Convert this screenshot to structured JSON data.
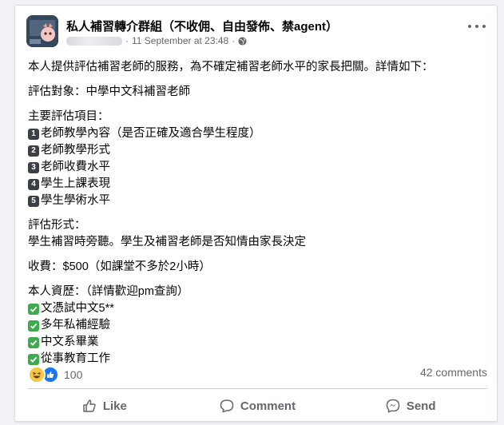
{
  "post": {
    "group_name": "私人補習轉介群組（不收佣、自由發佈、禁agent）",
    "timestamp": "11 September at 23:48",
    "meta_separator": "·",
    "privacy_icon": "globe-icon",
    "intro": "本人提供評估補習老師的服務，為不確定補習老師水平的家長把關。詳情如下：",
    "target": "評估對象：中學中文科補習老師",
    "items_heading": "主要評估項目：",
    "items": [
      {
        "num": "1",
        "text": "老師教學內容（是否正確及適合學生程度）"
      },
      {
        "num": "2",
        "text": "老師教學形式"
      },
      {
        "num": "3",
        "text": "老師收費水平"
      },
      {
        "num": "4",
        "text": "學生上課表現"
      },
      {
        "num": "5",
        "text": "學生學術水平"
      }
    ],
    "format_heading": "評估形式：",
    "format_text": "學生補習時旁聽。學生及補習老師是否知情由家長決定",
    "fee": "收費：$500（如課堂不多於2小時）",
    "quals_heading": "本人資歷：（詳情歡迎pm查詢）",
    "quals": [
      "文憑試中文5**",
      "多年私補經驗",
      "中文系畢業",
      "從事教育工作"
    ]
  },
  "stats": {
    "reaction_icons": [
      "haha-emoji-icon",
      "like-reaction-icon"
    ],
    "reaction_count": "100",
    "comments": "42 comments"
  },
  "actions": {
    "like": "Like",
    "comment": "Comment",
    "send": "Send"
  },
  "colors": {
    "text": "#050505",
    "muted": "#65676b",
    "like_blue": "#1877f2",
    "check_green": "#3ea94d",
    "keycap": "#3c3f45"
  }
}
